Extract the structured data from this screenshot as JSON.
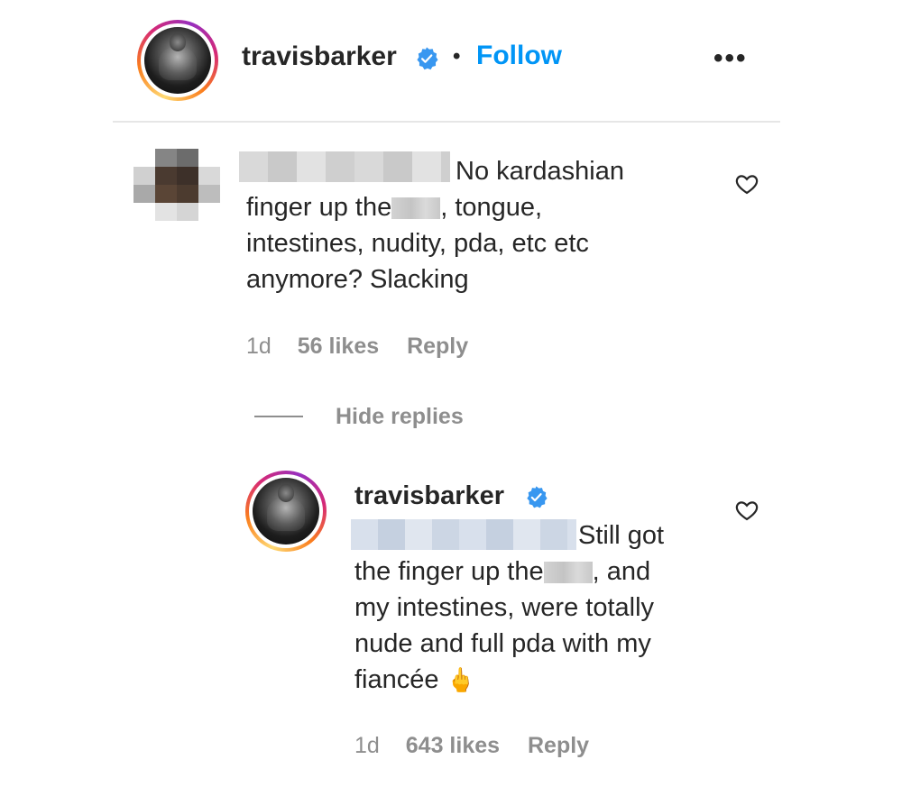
{
  "post_header": {
    "username": "travisbarker",
    "separator": "•",
    "follow_label": "Follow",
    "more_label": "•••"
  },
  "comments": [
    {
      "username_hidden": true,
      "text_lines": [
        "No kardashian",
        "finger up the",
        ", tongue,",
        "intestines, nudity, pda, etc etc",
        "anymore? Slacking"
      ],
      "time": "1d",
      "likes": "56 likes",
      "reply_label": "Reply",
      "hide_replies_label": "Hide replies"
    }
  ],
  "replies": [
    {
      "username": "travisbarker",
      "text_lines": [
        "Still got",
        "the finger up the",
        ", and",
        "my intestines, were totally",
        "nude and full pda with my",
        "fiancée",
        "🖕"
      ],
      "time": "1d",
      "likes": "643 likes",
      "reply_label": "Reply"
    }
  ],
  "colors": {
    "link_blue": "#0095f6",
    "text": "#262626",
    "muted": "#8e8e8e",
    "verified_blue": "#3897f0"
  }
}
